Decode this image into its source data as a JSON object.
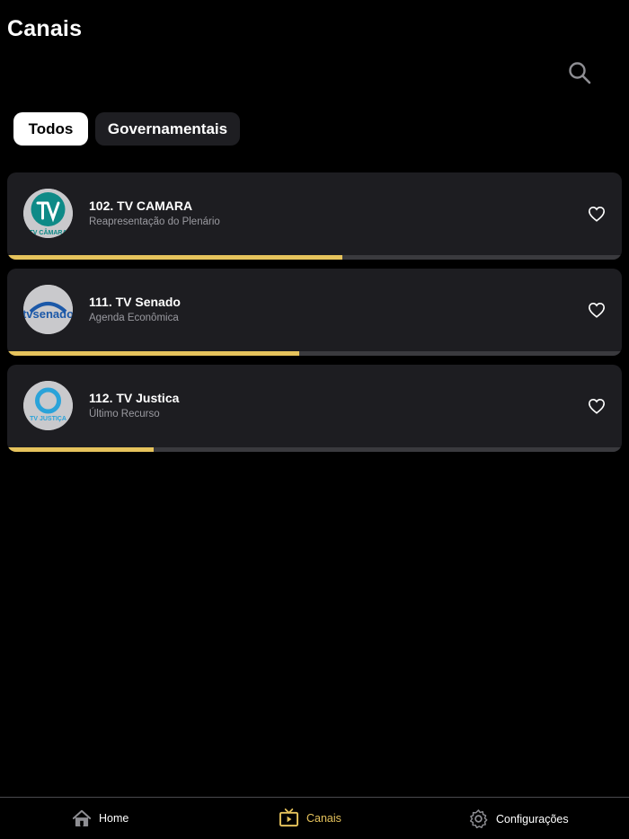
{
  "header": {
    "title": "Canais"
  },
  "search": {
    "icon": "search-icon"
  },
  "filters": [
    {
      "label": "Todos",
      "active": true
    },
    {
      "label": "Governamentais",
      "active": false
    }
  ],
  "channels": [
    {
      "name": "102. TV CAMARA",
      "program": "Reapresentação do Plenário",
      "progress": 0.546,
      "logo_text": "TV CÂMARA",
      "logo_color": "#0e8a87"
    },
    {
      "name": "111. TV Senado",
      "program": "Agenda Econômica",
      "progress": 0.475,
      "logo_text": "tvsenado",
      "logo_color": "#1b58a8"
    },
    {
      "name": "112. TV Justica",
      "program": "Último Recurso",
      "progress": 0.238,
      "logo_text": "TV JUSTIÇA",
      "logo_color": "#2aa3d9"
    }
  ],
  "tabbar": {
    "items": [
      {
        "label": "Home",
        "icon": "home-icon",
        "active": false
      },
      {
        "label": "Canais",
        "icon": "tv-icon",
        "active": true
      },
      {
        "label": "Configurações",
        "icon": "gear-icon",
        "active": false
      }
    ]
  },
  "colors": {
    "accent": "#e6c35c",
    "card": "#1d1d21",
    "track": "#3a3a3e"
  }
}
